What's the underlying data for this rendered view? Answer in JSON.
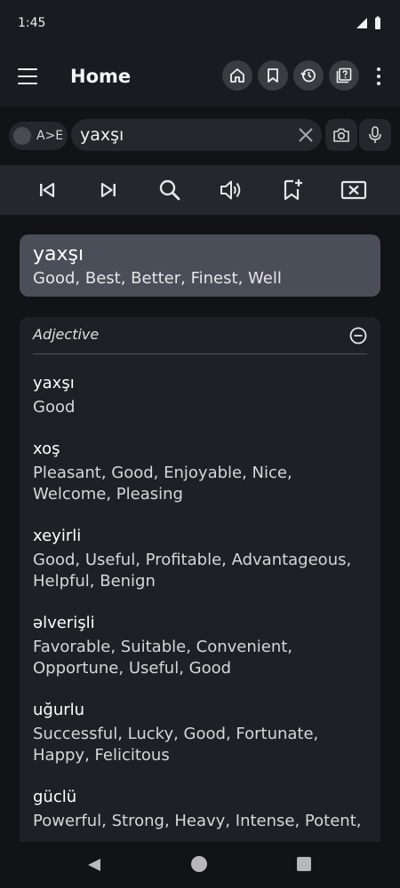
{
  "status_bar": {
    "time": "1:45",
    "icons": [
      "signal-icon",
      "battery-icon"
    ]
  },
  "app_bar": {
    "title": "Home",
    "actions": [
      "home-icon",
      "bookmark-icon",
      "history-icon",
      "quiz-icon"
    ],
    "overflow": "more-vert-icon"
  },
  "search": {
    "direction_label": "A>E",
    "query": "yaxşı",
    "clear": "close-icon",
    "camera": "camera-icon",
    "voice": "mic-icon"
  },
  "toolbar": {
    "buttons": [
      "skip-previous-icon",
      "skip-next-icon",
      "search-icon",
      "volume-icon",
      "bookmark-add-icon",
      "clear-box-icon"
    ]
  },
  "main_result": {
    "word": "yaxşı",
    "translation": "Good, Best, Better, Finest, Well"
  },
  "section": {
    "title": "Adjective",
    "collapse": "minus-circle-icon",
    "entries": [
      {
        "word": "yaxşı",
        "translation": "Good"
      },
      {
        "word": "xoş",
        "translation": "Pleasant, Good, Enjoyable, Nice, Welcome, Pleasing"
      },
      {
        "word": "xeyirli",
        "translation": "Good, Useful, Profitable, Advantageous, Helpful, Benign"
      },
      {
        "word": "əlverişli",
        "translation": "Favorable, Suitable, Convenient, Opportune, Useful, Good"
      },
      {
        "word": "uğurlu",
        "translation": "Successful, Lucky, Good, Fortunate, Happy, Felicitous"
      },
      {
        "word": "güclü",
        "translation": "Powerful, Strong, Heavy, Intense, Potent,"
      }
    ]
  },
  "colors": {
    "background": "#121316",
    "appbar": "#1a1b20",
    "toolbar": "#26272c",
    "main_card": "#4a4e58",
    "section_card": "#1f2025",
    "text": "#ffffff"
  }
}
